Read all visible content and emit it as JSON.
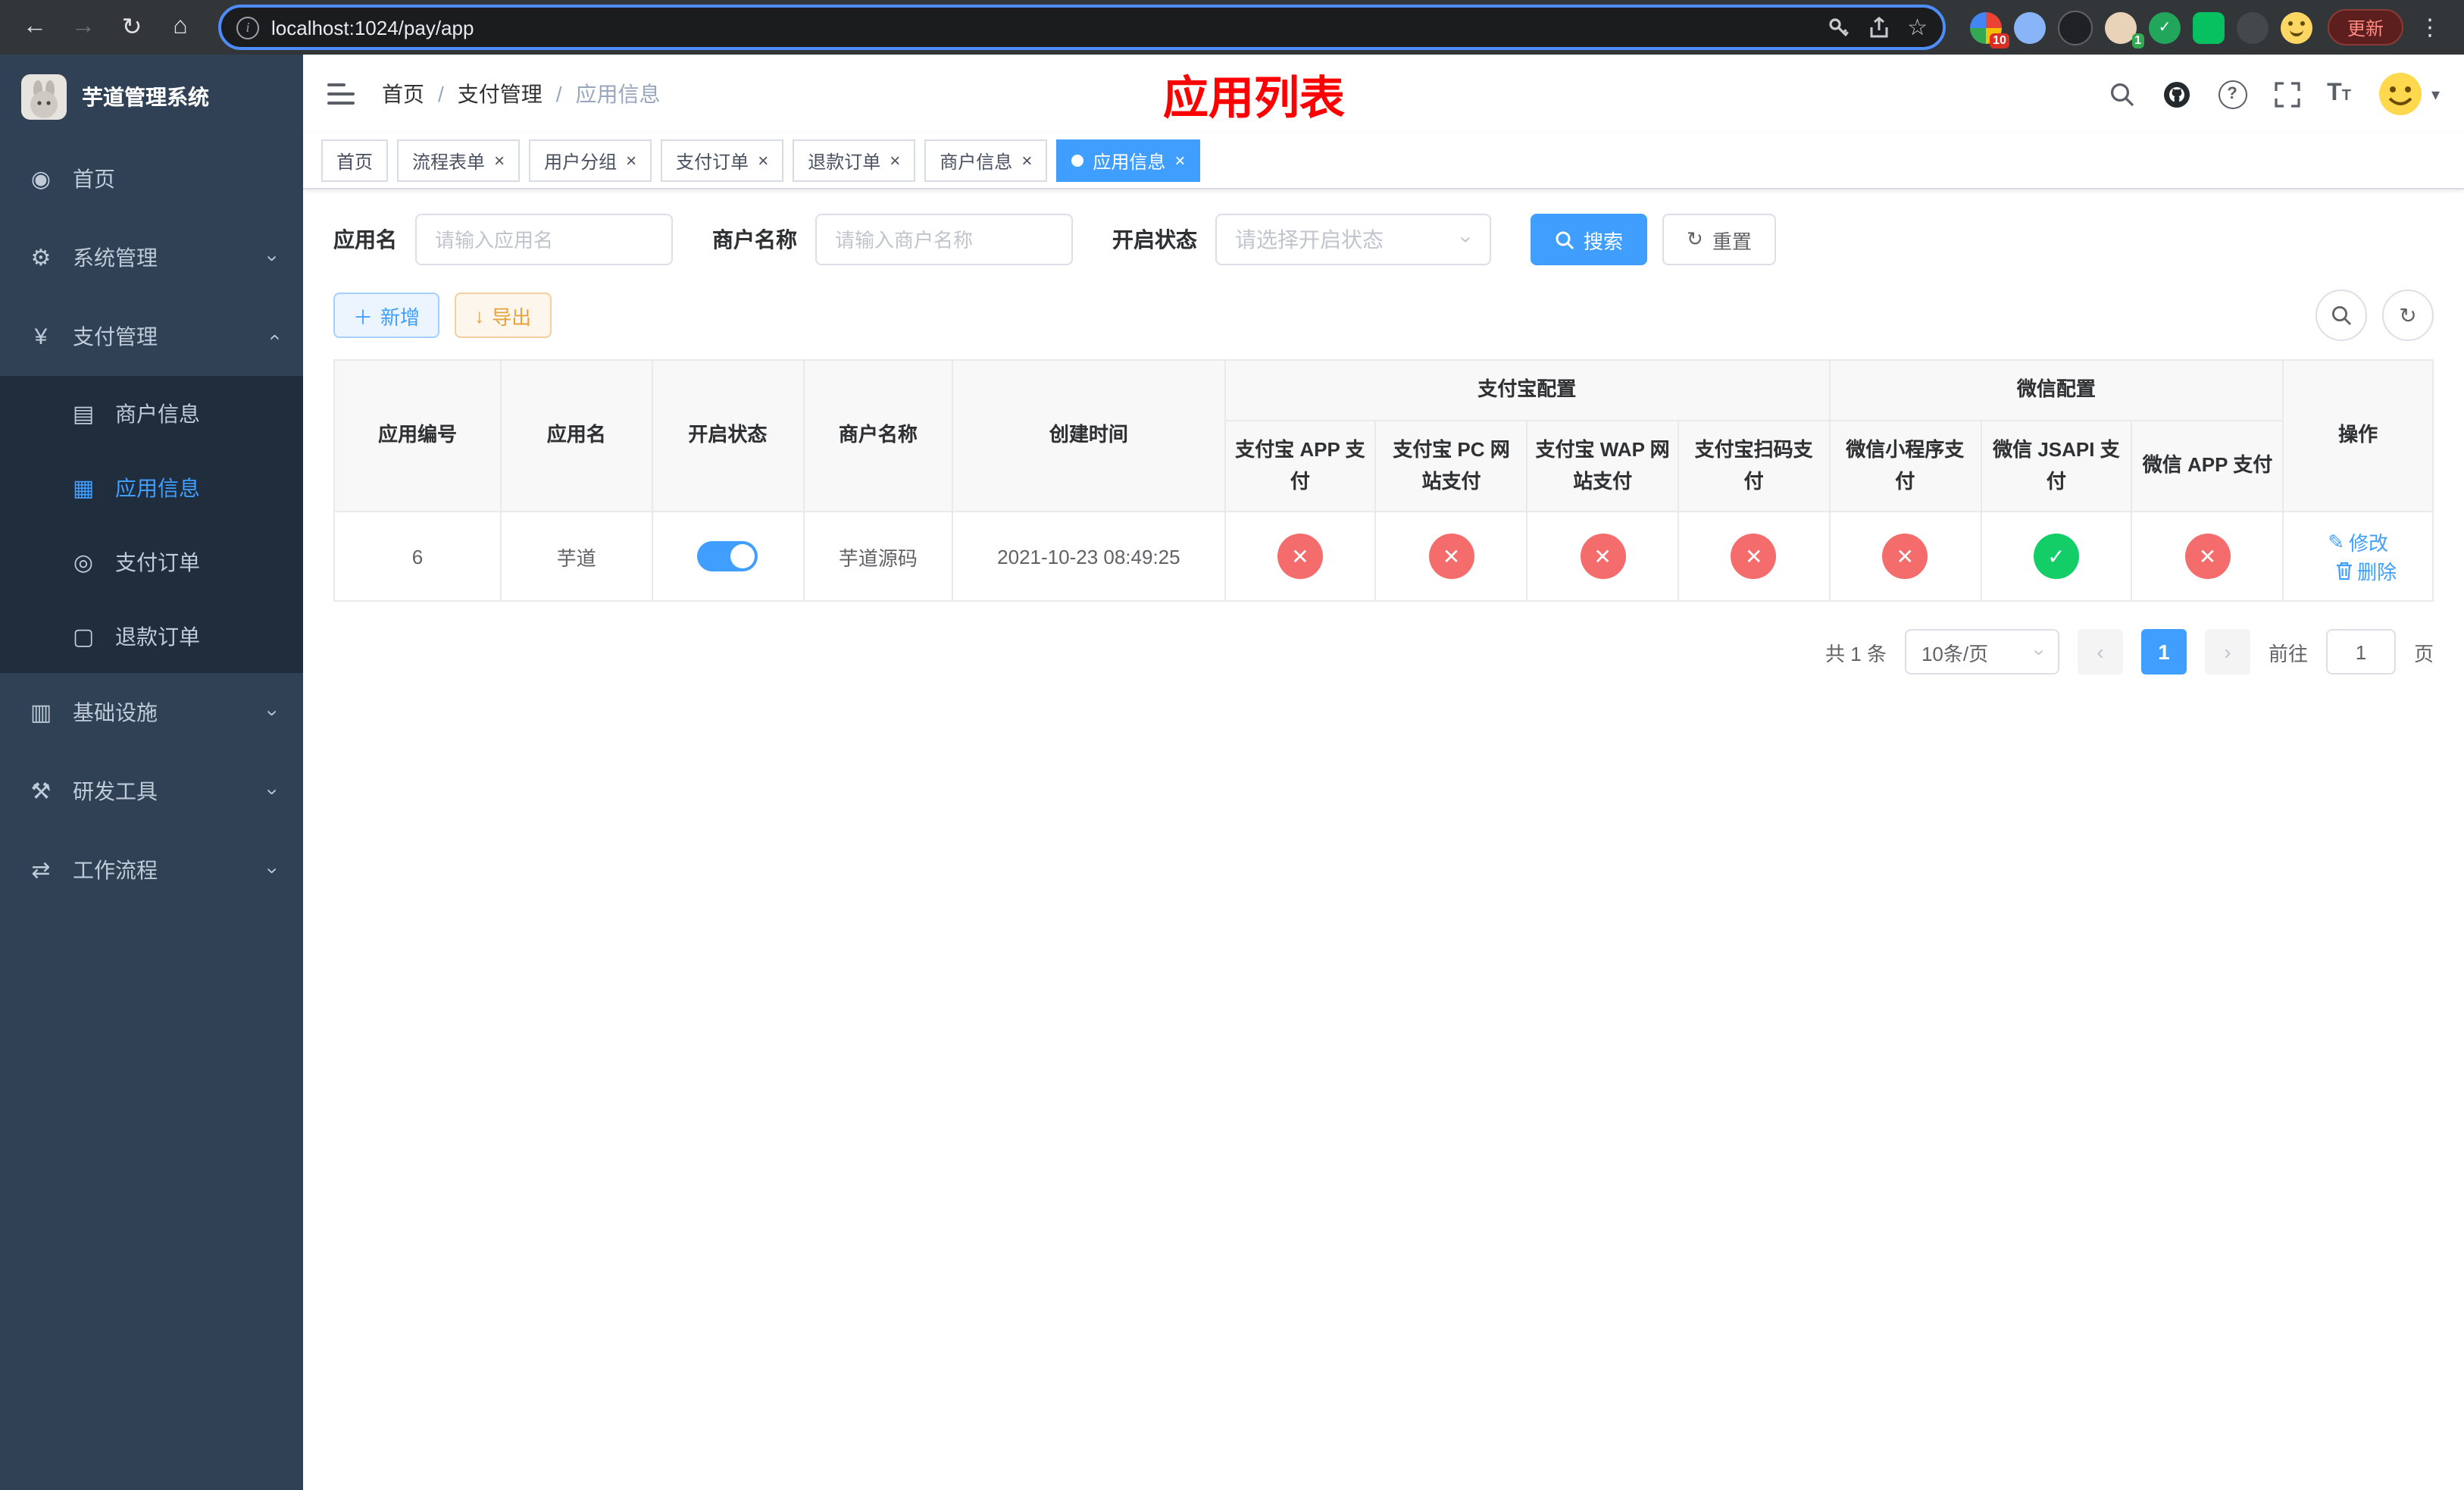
{
  "browser": {
    "url": "localhost:1024/pay/app",
    "update_button": "更新",
    "ext_badge_grid": "10",
    "ext_badge_person": "1"
  },
  "icons": {
    "back": "←",
    "forward": "→",
    "reload": "↻",
    "home": "⌂",
    "info": "i",
    "star": "☆",
    "dots": "⋮",
    "dashboard": "◉",
    "gear": "⚙",
    "yen": "¥",
    "merchant": "▤",
    "app": "▦",
    "order": "◎",
    "refund": "▢",
    "infra": "▥",
    "tools": "⚒",
    "workflow": "⇄",
    "chevron": "›",
    "caret": "▾",
    "plus": "＋",
    "download": "↓",
    "refresh": "↻",
    "close": "×",
    "check": "✓",
    "cross": "✕",
    "edit": "✎",
    "question": "?"
  },
  "sidebar": {
    "title": "芋道管理系统",
    "items": [
      {
        "label": "首页"
      },
      {
        "label": "系统管理"
      },
      {
        "label": "支付管理"
      },
      {
        "label": "商户信息"
      },
      {
        "label": "应用信息"
      },
      {
        "label": "支付订单"
      },
      {
        "label": "退款订单"
      },
      {
        "label": "基础设施"
      },
      {
        "label": "研发工具"
      },
      {
        "label": "工作流程"
      }
    ]
  },
  "header": {
    "breadcrumb": [
      "首页",
      "支付管理",
      "应用信息"
    ],
    "separator": "/",
    "page_title": "应用列表"
  },
  "tabs": [
    {
      "label": "首页"
    },
    {
      "label": "流程表单"
    },
    {
      "label": "用户分组"
    },
    {
      "label": "支付订单"
    },
    {
      "label": "退款订单"
    },
    {
      "label": "商户信息"
    },
    {
      "label": "应用信息"
    }
  ],
  "filters": {
    "app_name_label": "应用名",
    "app_name_placeholder": "请输入应用名",
    "merchant_label": "商户名称",
    "merchant_placeholder": "请输入商户名称",
    "status_label": "开启状态",
    "status_placeholder": "请选择开启状态",
    "search_button": "搜索",
    "reset_button": "重置"
  },
  "toolbar": {
    "add_button": "新增",
    "export_button": "导出"
  },
  "table": {
    "group_headers": {
      "alipay": "支付宝配置",
      "wechat": "微信配置"
    },
    "columns": [
      "应用编号",
      "应用名",
      "开启状态",
      "商户名称",
      "创建时间",
      "操作"
    ],
    "sub_columns": [
      "支付宝 APP 支付",
      "支付宝 PC 网站支付",
      "支付宝 WAP 网站支付",
      "支付宝扫码支付",
      "微信小程序支付",
      "微信 JSAPI 支付",
      "微信 APP 支付"
    ],
    "ops": {
      "edit": "修改",
      "delete": "删除"
    },
    "rows": [
      {
        "id": "6",
        "name": "芋道",
        "status_on": true,
        "merchant": "芋道源码",
        "created": "2021-10-23 08:49:25",
        "configs": [
          "no",
          "no",
          "no",
          "no",
          "no",
          "yes",
          "no"
        ]
      }
    ]
  },
  "pagination": {
    "total": "共 1 条",
    "page_size": "10条/页",
    "current_page": "1",
    "prev": "‹",
    "next": "›",
    "goto_label": "前往",
    "goto_value": "1",
    "goto_suffix": "页"
  }
}
